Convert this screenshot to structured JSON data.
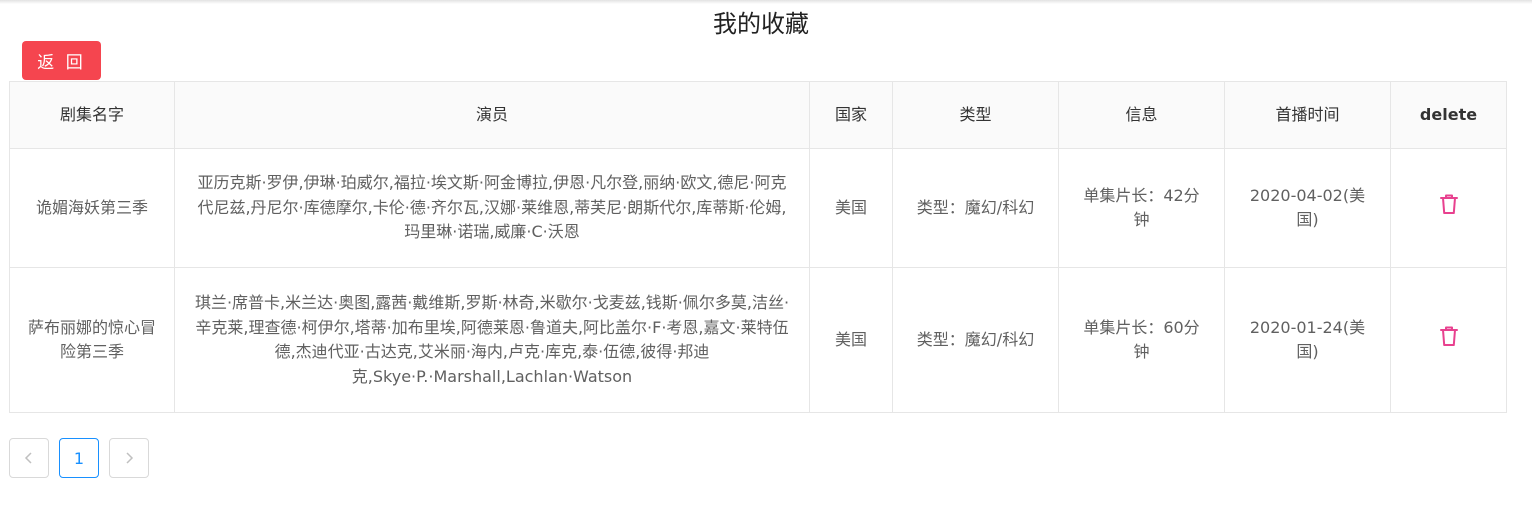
{
  "page": {
    "title": "我的收藏"
  },
  "toolbar": {
    "back_label": "返 回"
  },
  "table": {
    "headers": [
      "剧集名字",
      "演员",
      "国家",
      "类型",
      "信息",
      "首播时间",
      "delete"
    ],
    "rows": [
      {
        "name": "诡媚海妖第三季",
        "actors": "亚历克斯·罗伊,伊琳·珀威尔,福拉·埃文斯·阿金博拉,伊恩·凡尔登,丽纳·欧文,德尼·阿克代尼兹,丹尼尔·库德摩尔,卡伦·德·齐尔瓦,汉娜·莱维恩,蒂芙尼·朗斯代尔,库蒂斯·伦姆,玛里琳·诺瑞,威廉·C·沃恩",
        "country": "美国",
        "genre": "类型：魔幻/科幻",
        "info": "单集片长：42分钟",
        "premiere": "2020-04-02(美国)",
        "delete_icon": "trash-icon"
      },
      {
        "name": "萨布丽娜的惊心冒险第三季",
        "actors": "琪兰·席普卡,米兰达·奥图,露茜·戴维斯,罗斯·林奇,米歇尔·戈麦兹,钱斯·佩尔多莫,洁丝·辛克莱,理查德·柯伊尔,塔蒂·加布里埃,阿德莱恩·鲁道夫,阿比盖尔·F·考恩,嘉文·莱特伍德,杰迪代亚·古达克,艾米丽·海内,卢克·库克,泰·伍德,彼得·邦迪克,Skye·P.·Marshall,Lachlan·Watson",
        "country": "美国",
        "genre": "类型：魔幻/科幻",
        "info": "单集片长：60分钟",
        "premiere": "2020-01-24(美国)",
        "delete_icon": "trash-icon"
      }
    ]
  },
  "pagination": {
    "prev_icon": "chevron-left-icon",
    "current_page": "1",
    "next_icon": "chevron-right-icon"
  },
  "colors": {
    "accent": "#f5454f",
    "delete": "#e8418f",
    "page_active": "#1890ff"
  }
}
